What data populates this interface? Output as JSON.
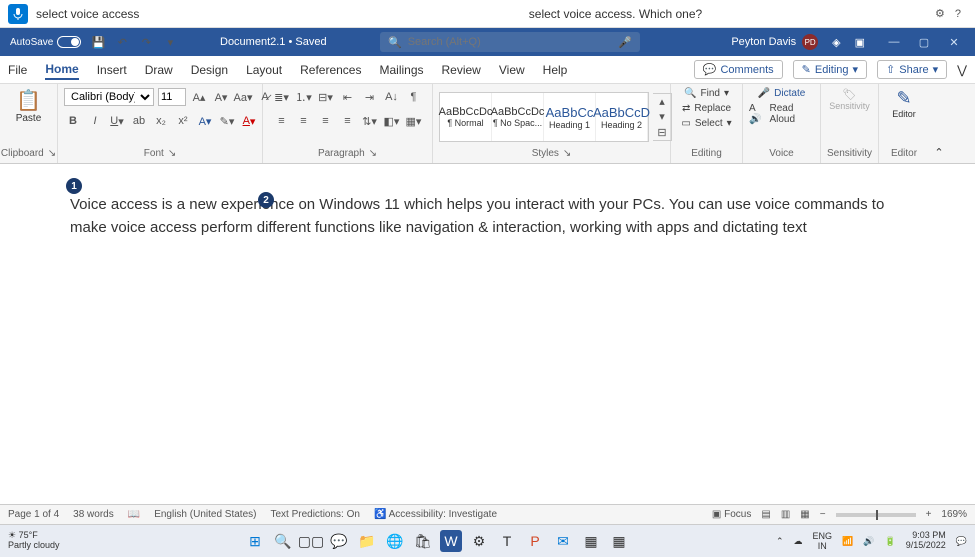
{
  "voice": {
    "input_text": "select voice access",
    "prompt": "select voice access. Which one?"
  },
  "title": {
    "autosave": "AutoSave",
    "doc": "Document2.1 • Saved",
    "search_placeholder": "Search (Alt+Q)",
    "user": "Peyton Davis",
    "initials": "PD"
  },
  "tabs": {
    "file": "File",
    "home": "Home",
    "insert": "Insert",
    "draw": "Draw",
    "design": "Design",
    "layout": "Layout",
    "references": "References",
    "mailings": "Mailings",
    "review": "Review",
    "view": "View",
    "help": "Help",
    "comments": "Comments",
    "editing": "Editing",
    "share": "Share"
  },
  "ribbon": {
    "clipboard": {
      "paste": "Paste",
      "label": "Clipboard"
    },
    "font": {
      "name": "Calibri (Body)",
      "size": "11",
      "label": "Font"
    },
    "paragraph": {
      "label": "Paragraph"
    },
    "styles": {
      "label": "Styles",
      "items": [
        {
          "preview": "AaBbCcDc",
          "name": "¶ Normal"
        },
        {
          "preview": "AaBbCcDc",
          "name": "¶ No Spac..."
        },
        {
          "preview": "AaBbCc",
          "name": "Heading 1"
        },
        {
          "preview": "AaBbCcD",
          "name": "Heading 2"
        }
      ]
    },
    "editing": {
      "find": "Find",
      "replace": "Replace",
      "select": "Select",
      "label": "Editing"
    },
    "voice": {
      "dictate": "Dictate",
      "read": "Read Aloud",
      "label": "Voice"
    },
    "sensitivity": {
      "btn": "Sensitivity",
      "label": "Sensitivity"
    },
    "editor": {
      "btn": "Editor",
      "label": "Editor"
    }
  },
  "doc": {
    "body": "Voice access is a new experience on Windows 11 which helps you interact with your PCs. You can use voice commands to make voice access perform different functions like navigation & interaction, working with apps and dictating text",
    "badge1": "1",
    "badge2": "2"
  },
  "status": {
    "page": "Page 1 of 4",
    "words": "38 words",
    "lang": "English (United States)",
    "predictions": "Text Predictions: On",
    "access": "Accessibility: Investigate",
    "focus": "Focus",
    "zoom": "169%"
  },
  "taskbar": {
    "temp": "75°F",
    "cond": "Partly cloudy",
    "lang": "ENG",
    "region": "IN",
    "time": "9:03 PM",
    "date": "9/15/2022"
  }
}
